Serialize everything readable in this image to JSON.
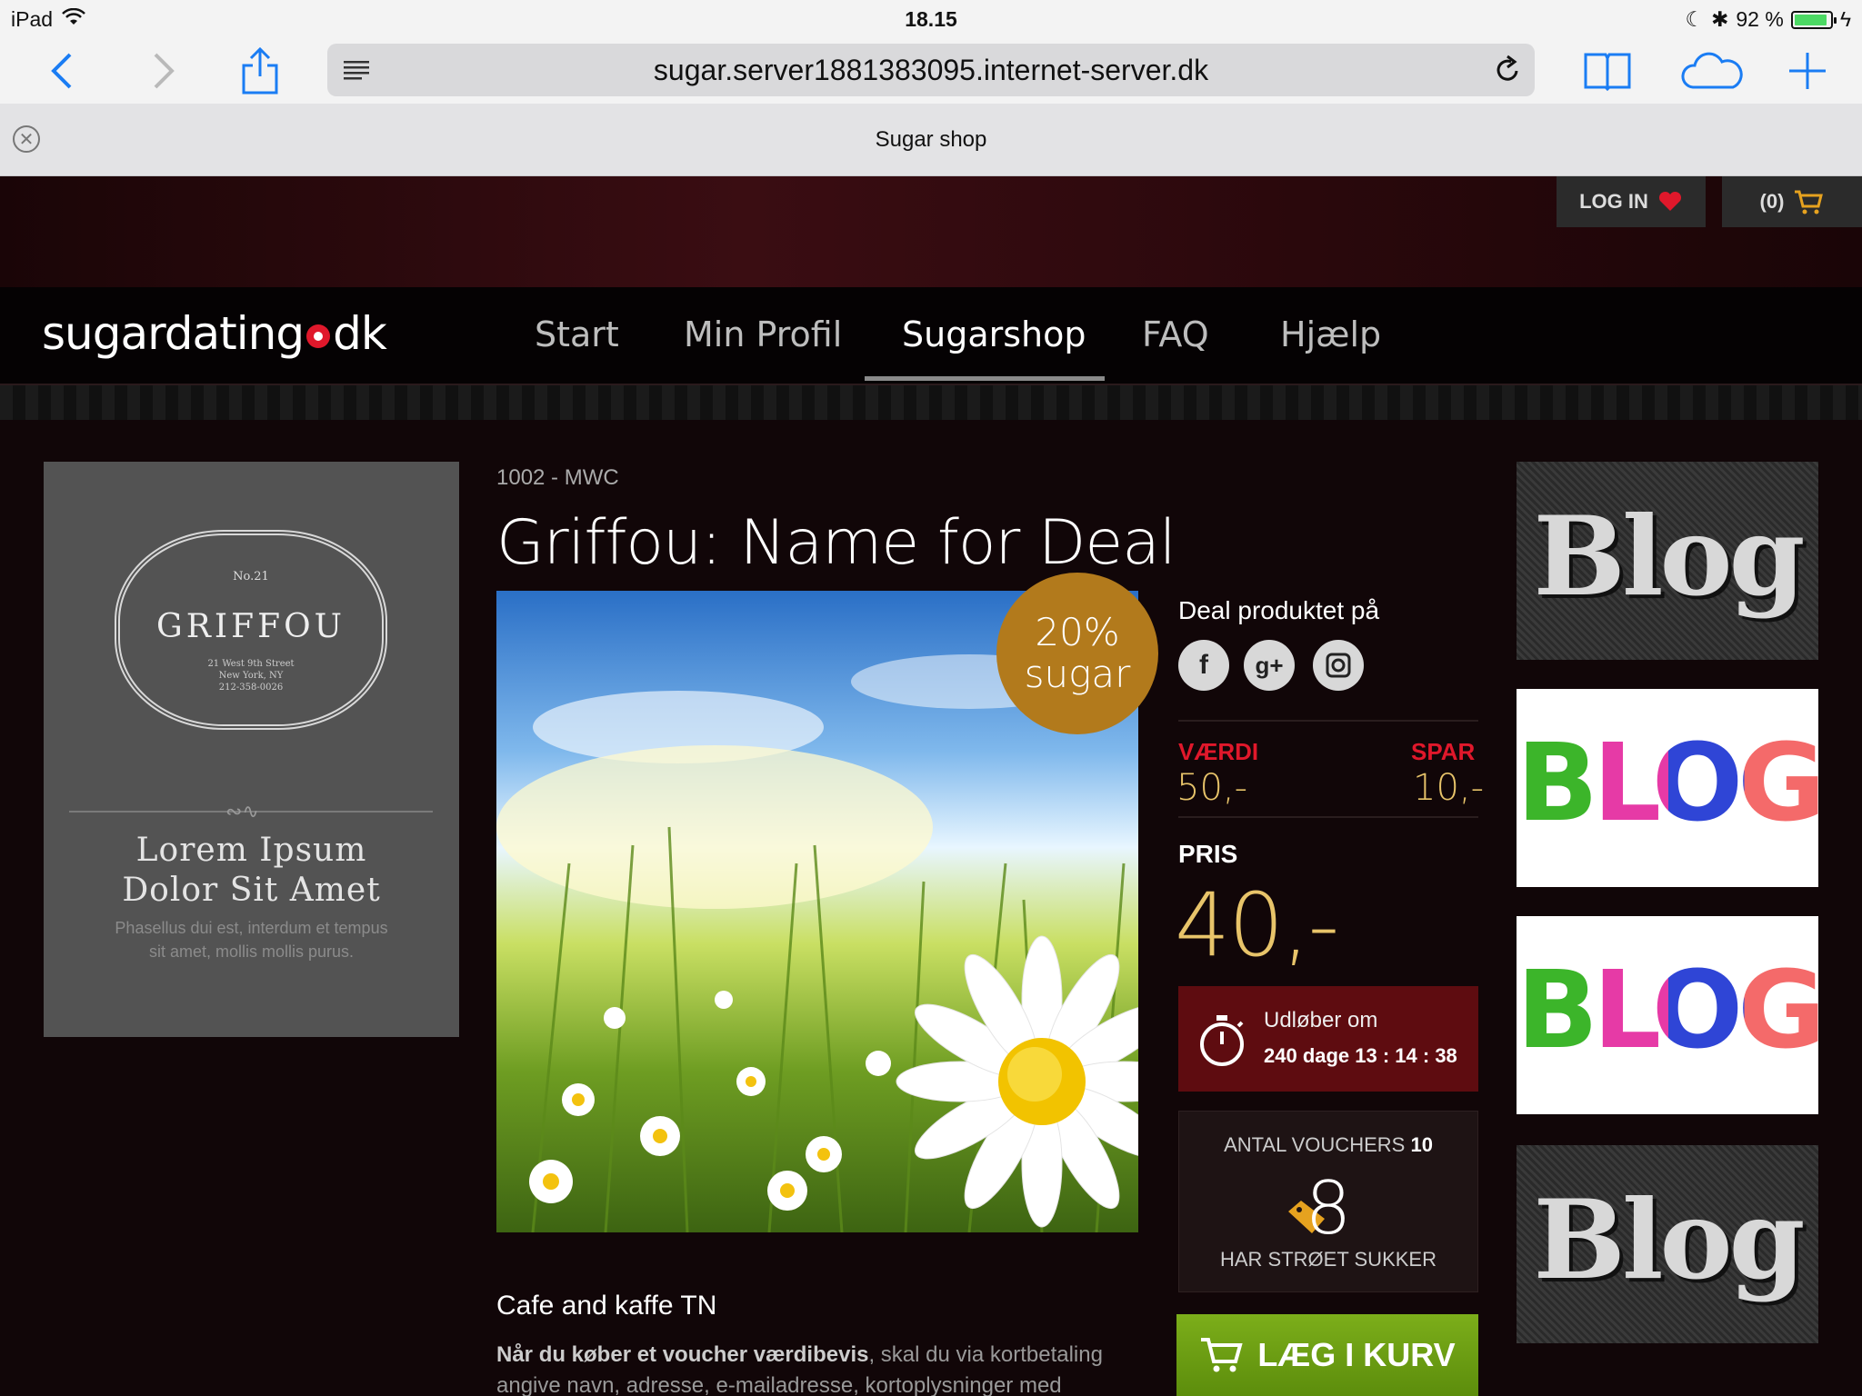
{
  "status": {
    "device": "iPad",
    "time": "18.15",
    "battery": "92 %",
    "battery_level": 0.92
  },
  "browser": {
    "url": "sugar.server1881383095.internet-server.dk",
    "tab_title": "Sugar shop"
  },
  "header": {
    "login_label": "LOG IN",
    "cart_label": "(0)"
  },
  "logo": {
    "part1": "sugardating",
    "part2": "dk"
  },
  "nav": {
    "items": [
      {
        "label": "Start"
      },
      {
        "label": "Min Profil"
      },
      {
        "label": "Sugarshop"
      },
      {
        "label": "FAQ"
      },
      {
        "label": "Hjælp"
      }
    ],
    "active_index": 2
  },
  "ad": {
    "no": "No.21",
    "brand": "GRIFFOU",
    "address_1": "21 West 9th Street",
    "address_2": "New York, NY",
    "address_3": "212-358-0026",
    "headline_1": "Lorem Ipsum",
    "headline_2": "Dolor Sit Amet",
    "sub_1": "Phasellus dui est, interdum et tempus",
    "sub_2": "sit amet, mollis mollis purus."
  },
  "product": {
    "sku": "1002 - MWC",
    "title": "Griffou: Name for Deal",
    "badge_percent": "20%",
    "badge_word": "sugar",
    "deal_label": "Deal produktet på",
    "value_label": "VÆRDI",
    "value": "50,-",
    "save_label": "SPAR",
    "save": "10,-",
    "price_label": "PRIS",
    "price": "40,-",
    "expiry_label": "Udløber om",
    "expiry_value": "240 dage 13 : 14 : 38",
    "vouchers_label": "ANTAL VOUCHERS",
    "vouchers_total": "10",
    "vouchers_count": "8",
    "vouchers_sub": "HAR STRØET SUKKER",
    "add_to_cart": "LÆG I KURV"
  },
  "description": {
    "title": "Cafe and kaffe TN",
    "bold_text": "Når du køber et voucher værdibevis",
    "text": ", skal du via kortbetaling angive navn, adresse, e-mailadresse, kortoplysninger med"
  },
  "sidebar": {
    "blog_1": "Blog",
    "blog_2": "BLOG",
    "blog_3": "BLOG",
    "blog_4": "Blog"
  },
  "colors": {
    "accent_red": "#e0182b",
    "gold": "#e8c46a",
    "badge": "#b27a1c",
    "cart_green": "#6a9d12",
    "ios_blue": "#1a7cf3"
  }
}
